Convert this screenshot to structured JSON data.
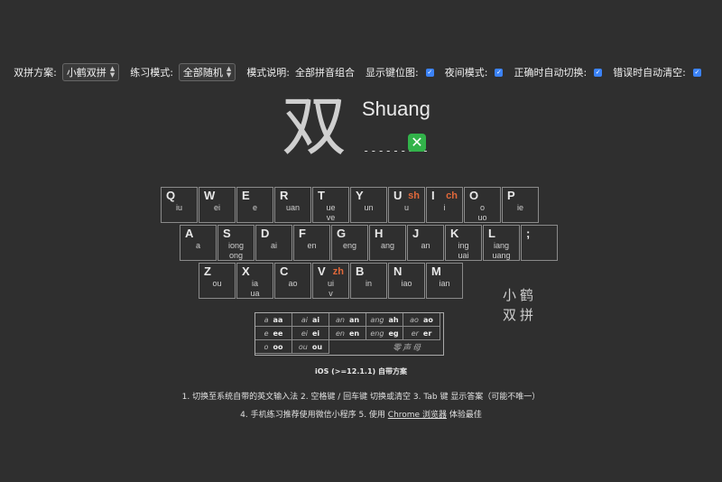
{
  "toolbar": {
    "scheme_label": "双拼方案:",
    "scheme_value": "小鹤双拼",
    "mode_label": "练习模式:",
    "mode_value": "全部随机",
    "desc_label": "模式说明:",
    "desc_value": "全部拼音组合",
    "show_keys_label": "显示键位图:",
    "night_label": "夜间模式:",
    "auto_switch_label": "正确时自动切换:",
    "auto_clear_label": "错误时自动清空:",
    "show_keys_checked": true,
    "night_checked": true,
    "auto_switch_checked": true,
    "auto_clear_checked": true
  },
  "practice": {
    "character": "双",
    "pinyin": "Shuang",
    "answer_placeholder": "---------",
    "result_icon": "cross-mark-icon"
  },
  "keyboard": {
    "rows": [
      [
        {
          "key": "Q",
          "initial": "",
          "finals": [
            "iu",
            ""
          ]
        },
        {
          "key": "W",
          "initial": "",
          "finals": [
            "ei",
            ""
          ]
        },
        {
          "key": "E",
          "initial": "",
          "finals": [
            "e",
            ""
          ]
        },
        {
          "key": "R",
          "initial": "",
          "finals": [
            "uan",
            ""
          ]
        },
        {
          "key": "T",
          "initial": "",
          "finals": [
            "ue",
            "ve"
          ]
        },
        {
          "key": "Y",
          "initial": "",
          "finals": [
            "un",
            ""
          ]
        },
        {
          "key": "U",
          "initial": "sh",
          "finals": [
            "u",
            ""
          ]
        },
        {
          "key": "I",
          "initial": "ch",
          "finals": [
            "i",
            ""
          ]
        },
        {
          "key": "O",
          "initial": "",
          "finals": [
            "o",
            "uo"
          ]
        },
        {
          "key": "P",
          "initial": "",
          "finals": [
            "ie",
            ""
          ]
        }
      ],
      [
        {
          "key": "A",
          "initial": "",
          "finals": [
            "a",
            ""
          ]
        },
        {
          "key": "S",
          "initial": "",
          "finals": [
            "iong",
            "ong"
          ]
        },
        {
          "key": "D",
          "initial": "",
          "finals": [
            "ai",
            ""
          ]
        },
        {
          "key": "F",
          "initial": "",
          "finals": [
            "en",
            ""
          ]
        },
        {
          "key": "G",
          "initial": "",
          "finals": [
            "eng",
            ""
          ]
        },
        {
          "key": "H",
          "initial": "",
          "finals": [
            "ang",
            ""
          ]
        },
        {
          "key": "J",
          "initial": "",
          "finals": [
            "an",
            ""
          ]
        },
        {
          "key": "K",
          "initial": "",
          "finals": [
            "ing",
            "uai"
          ]
        },
        {
          "key": "L",
          "initial": "",
          "finals": [
            "iang",
            "uang"
          ]
        },
        {
          "key": ";",
          "initial": "",
          "finals": [
            "",
            ""
          ]
        }
      ],
      [
        {
          "key": "Z",
          "initial": "",
          "finals": [
            "ou",
            ""
          ]
        },
        {
          "key": "X",
          "initial": "",
          "finals": [
            "ia",
            "ua"
          ]
        },
        {
          "key": "C",
          "initial": "",
          "finals": [
            "ao",
            ""
          ]
        },
        {
          "key": "V",
          "initial": "zh",
          "finals": [
            "ui",
            "v"
          ]
        },
        {
          "key": "B",
          "initial": "",
          "finals": [
            "in",
            ""
          ]
        },
        {
          "key": "N",
          "initial": "",
          "finals": [
            "iao",
            ""
          ]
        },
        {
          "key": "M",
          "initial": "",
          "finals": [
            "ian",
            ""
          ]
        }
      ]
    ],
    "logo_line1": "小鹤",
    "logo_line2": "双拼"
  },
  "zero_initials": {
    "rows": [
      [
        [
          "a",
          "aa"
        ],
        [
          "ai",
          "ai"
        ],
        [
          "an",
          "an"
        ],
        [
          "ang",
          "ah"
        ],
        [
          "ao",
          "ao"
        ]
      ],
      [
        [
          "e",
          "ee"
        ],
        [
          "ei",
          "ei"
        ],
        [
          "en",
          "en"
        ],
        [
          "eng",
          "eg"
        ],
        [
          "er",
          "er"
        ]
      ],
      [
        [
          "o",
          "oo"
        ],
        [
          "ou",
          "ou"
        ]
      ]
    ],
    "label": "零声母"
  },
  "scheme_caption": "iOS (>=12.1.1) 自带方案",
  "tips": {
    "tip1": "1. 切换至系统自带的英文输入法   2. 空格键 / 回车键 切换或清空   3. Tab 键 显示答案（可能不唯一）",
    "tip2_pre": "4. 手机练习推荐使用微信小程序   5. 使用 ",
    "tip2_link": "Chrome 浏览器",
    "tip2_post": " 体验最佳"
  }
}
